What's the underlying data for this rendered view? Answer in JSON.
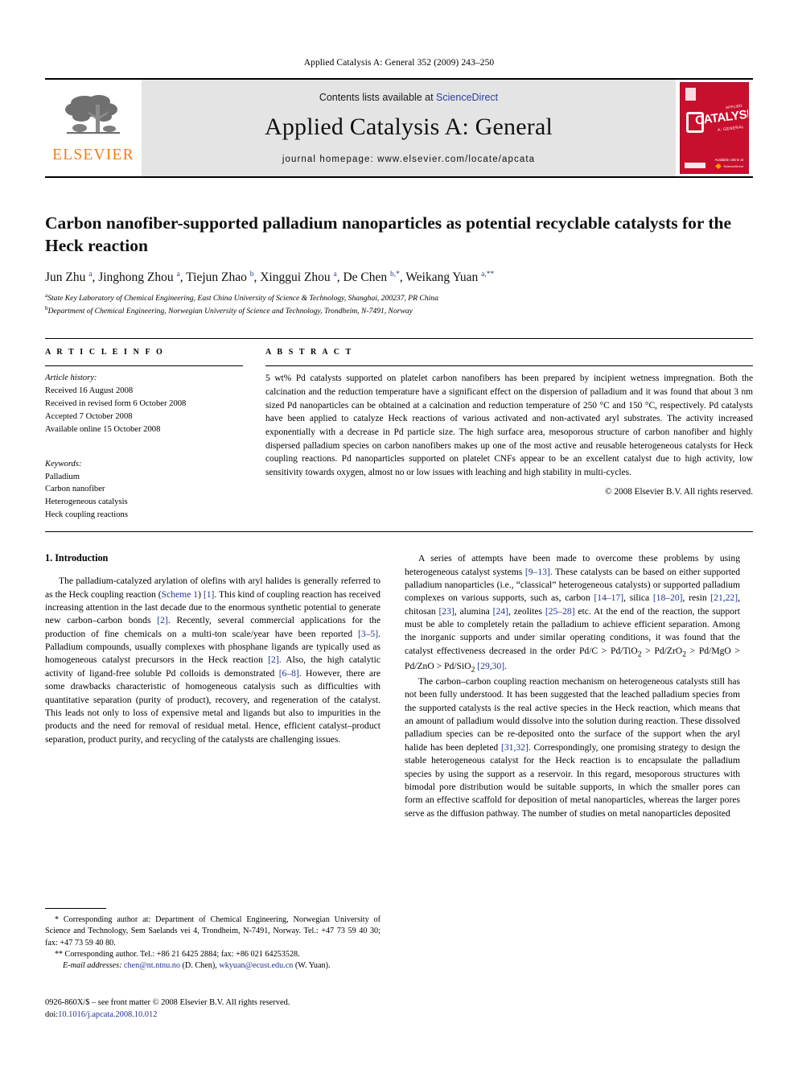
{
  "running_head": "Applied Catalysis A: General 352 (2009) 243–250",
  "masthead": {
    "publisher_logo_word": "ELSEVIER",
    "publisher_logo_name": "elsevier-tree-logo",
    "contents_prefix": "Contents lists available at ",
    "contents_link": "ScienceDirect",
    "journal_title": "Applied Catalysis A: General",
    "homepage": "journal homepage: www.elsevier.com/locate/apcata",
    "cover": {
      "title": "CATALYSIS",
      "superline": "APPLIED",
      "subline": "A: GENERAL",
      "footer": "Available online at",
      "sciencedirect": "ScienceDirect"
    }
  },
  "article": {
    "title": "Carbon nanofiber-supported palladium nanoparticles as potential recyclable catalysts for the Heck reaction",
    "authors_html": "Jun Zhu <sup>a</sup>, Jinghong Zhou <sup>a</sup>, Tiejun Zhao <sup>b</sup>, Xinggui Zhou <sup>a</sup>, De Chen <sup>b,*</sup>, Weikang Yuan <sup>a,**</sup>",
    "affiliations": [
      "State Key Laboratory of Chemical Engineering, East China University of Science & Technology, Shanghai, 200237, PR China",
      "Department of Chemical Engineering, Norwegian University of Science and Technology, Trondheim, N-7491, Norway"
    ],
    "affiliation_marks": [
      "a",
      "b"
    ]
  },
  "article_info": {
    "heading": "A R T I C L E    I N F O",
    "history_label": "Article history:",
    "history": [
      "Received 16 August 2008",
      "Received in revised form 6 October 2008",
      "Accepted 7 October 2008",
      "Available online 15 October 2008"
    ],
    "keywords_label": "Keywords:",
    "keywords": [
      "Palladium",
      "Carbon nanofiber",
      "Heterogeneous catalysis",
      "Heck coupling reactions"
    ]
  },
  "abstract": {
    "heading": "A B S T R A C T",
    "text": "5 wt% Pd catalysts supported on platelet carbon nanofibers has been prepared by incipient wetness impregnation. Both the calcination and the reduction temperature have a significant effect on the dispersion of palladium and it was found that about 3 nm sized Pd nanoparticles can be obtained at a calcination and reduction temperature of 250 °C and 150 °C, respectively. Pd catalysts have been applied to catalyze Heck reactions of various activated and non-activated aryl substrates. The activity increased exponentially with a decrease in Pd particle size. The high surface area, mesoporous structure of carbon nanofiber and highly dispersed palladium species on carbon nanofibers makes up one of the most active and reusable heterogeneous catalysts for Heck coupling reactions. Pd nanoparticles supported on platelet CNFs appear to be an excellent catalyst due to high activity, low sensitivity towards oxygen, almost no or low issues with leaching and high stability in multi-cycles.",
    "copyright": "© 2008 Elsevier B.V. All rights reserved."
  },
  "body": {
    "section_title": "1. Introduction",
    "left_paragraphs": [
      "The palladium-catalyzed arylation of olefins with aryl halides is generally referred to as the Heck coupling reaction (Scheme 1) [1]. This kind of coupling reaction has received increasing attention in the last decade due to the enormous synthetic potential to generate new carbon–carbon bonds [2]. Recently, several commercial applications for the production of fine chemicals on a multi-ton scale/year have been reported [3–5]. Palladium compounds, usually complexes with phosphane ligands are typically used as homogeneous catalyst precursors in the Heck reaction [2]. Also, the high catalytic activity of ligand-free soluble Pd colloids is demonstrated [6–8]. However, there are some drawbacks characteristic of homogeneous catalysis such as difficulties with quantitative separation (purity of product), recovery, and regeneration of the catalyst. This leads not only to loss of expensive metal and ligands but also to impurities in the products and the need for removal of residual metal. Hence, efficient catalyst–product separation, product purity, and recycling of the catalysts are challenging issues."
    ],
    "right_paragraphs": [
      "A series of attempts have been made to overcome these problems by using heterogeneous catalyst systems [9–13]. These catalysts can be based on either supported palladium nanoparticles (i.e., “classical” heterogeneous catalysts) or supported palladium complexes on various supports, such as, carbon [14–17], silica [18–20], resin [21,22], chitosan [23], alumina [24], zeolites [25–28] etc. At the end of the reaction, the support must be able to completely retain the palladium to achieve efficient separation. Among the inorganic supports and under similar operating conditions, it was found that the catalyst effectiveness decreased in the order Pd/C > Pd/TiO2 > Pd/ZrO2 > Pd/MgO > Pd/ZnO > Pd/SiO2 [29,30].",
      "The carbon–carbon coupling reaction mechanism on heterogeneous catalysts still has not been fully understood. It has been suggested that the leached palladium species from the supported catalysts is the real active species in the Heck reaction, which means that an amount of palladium would dissolve into the solution during reaction. These dissolved palladium species can be re-deposited onto the surface of the support when the aryl halide has been depleted [31,32]. Correspondingly, one promising strategy to design the stable heterogeneous catalyst for the Heck reaction is to encapsulate the palladium species by using the support as a reservoir. In this regard, mesoporous structures with bimodal pore distribution would be suitable supports, in which the smaller pores can form an effective scaffold for deposition of metal nanoparticles, whereas the larger pores serve as the diffusion pathway. The number of studies on metal nanoparticles deposited"
    ]
  },
  "footnotes": {
    "corresponding_1_mark": "*",
    "corresponding_1": "Corresponding author at: Department of Chemical Engineering, Norwegian University of Science and Technology, Sem Saelands vei 4, Trondheim, N-7491, Norway. Tel.: +47 73 59 40 30; fax: +47 73 59 40 80.",
    "corresponding_2_mark": "**",
    "corresponding_2": "Corresponding author. Tel.: +86 21 6425 2884; fax: +86 021 64253528.",
    "email_label": "E-mail addresses:",
    "email_1": "chen@nt.ntnu.no",
    "email_1_name": "(D. Chen)",
    "email_2": "wkyuan@ecust.edu.cn",
    "email_2_name": "(W. Yuan)."
  },
  "imprint": {
    "line1": "0926-860X/$ – see front matter © 2008 Elsevier B.V. All rights reserved.",
    "doi_label": "doi:",
    "doi_value": "10.1016/j.apcata.2008.10.012"
  },
  "colors": {
    "link_blue": "#24348c",
    "sciencedirect_blue": "#2b3fa0",
    "elsevier_orange": "#f07e13",
    "cover_red": "#c8102e",
    "masthead_grey": "#e4e4e4"
  }
}
